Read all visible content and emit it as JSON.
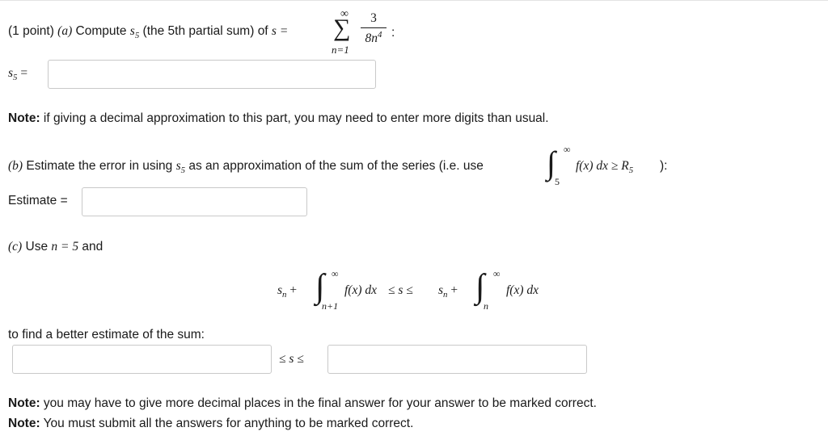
{
  "part_a": {
    "prefix": "(1 point) ",
    "label": "(a)",
    "text": " Compute ",
    "s5_label": "(the 5th partial sum) of ",
    "series_upper": "∞",
    "series_lower": "n=1",
    "numerator": "3",
    "denominator": "8n",
    "den_power": "4",
    "trailing": ":",
    "answer_label": "s",
    "answer_sub": "5",
    "answer_eq": "=",
    "answer_value": "",
    "note_bold": "Note:",
    "note_text": " if giving a decimal approximation to this part, you may need to enter more digits than usual."
  },
  "part_b": {
    "label": "(b)",
    "text_before": " Estimate the error in using ",
    "text_middle": " as an approximation of the sum of the series (i.e. use ",
    "int_upper": "∞",
    "int_lower": "5",
    "integrand": "f(x) dx ≥ R",
    "r_sub": "5",
    "text_after": " ):",
    "estimate_label": "Estimate =",
    "estimate_value": ""
  },
  "part_c": {
    "label": "(c)",
    "text": " Use ",
    "n_eq": "n = 5",
    "and": " and",
    "int1_upper": "∞",
    "int1_lower": "n+1",
    "int2_upper": "∞",
    "int2_lower": "n",
    "integrand": "f(x) dx",
    "ineq_middle": "≤ s ≤",
    "to_find": "to find a better estimate of the sum:",
    "lower_value": "",
    "upper_value": "",
    "between": "≤ s ≤"
  },
  "notes": {
    "note1_bold": "Note:",
    "note1_text": " you may have to give more decimal places in the final answer for your answer to be marked correct.",
    "note2_bold": "Note:",
    "note2_text": " You must submit all the answers for anything to be marked correct."
  }
}
